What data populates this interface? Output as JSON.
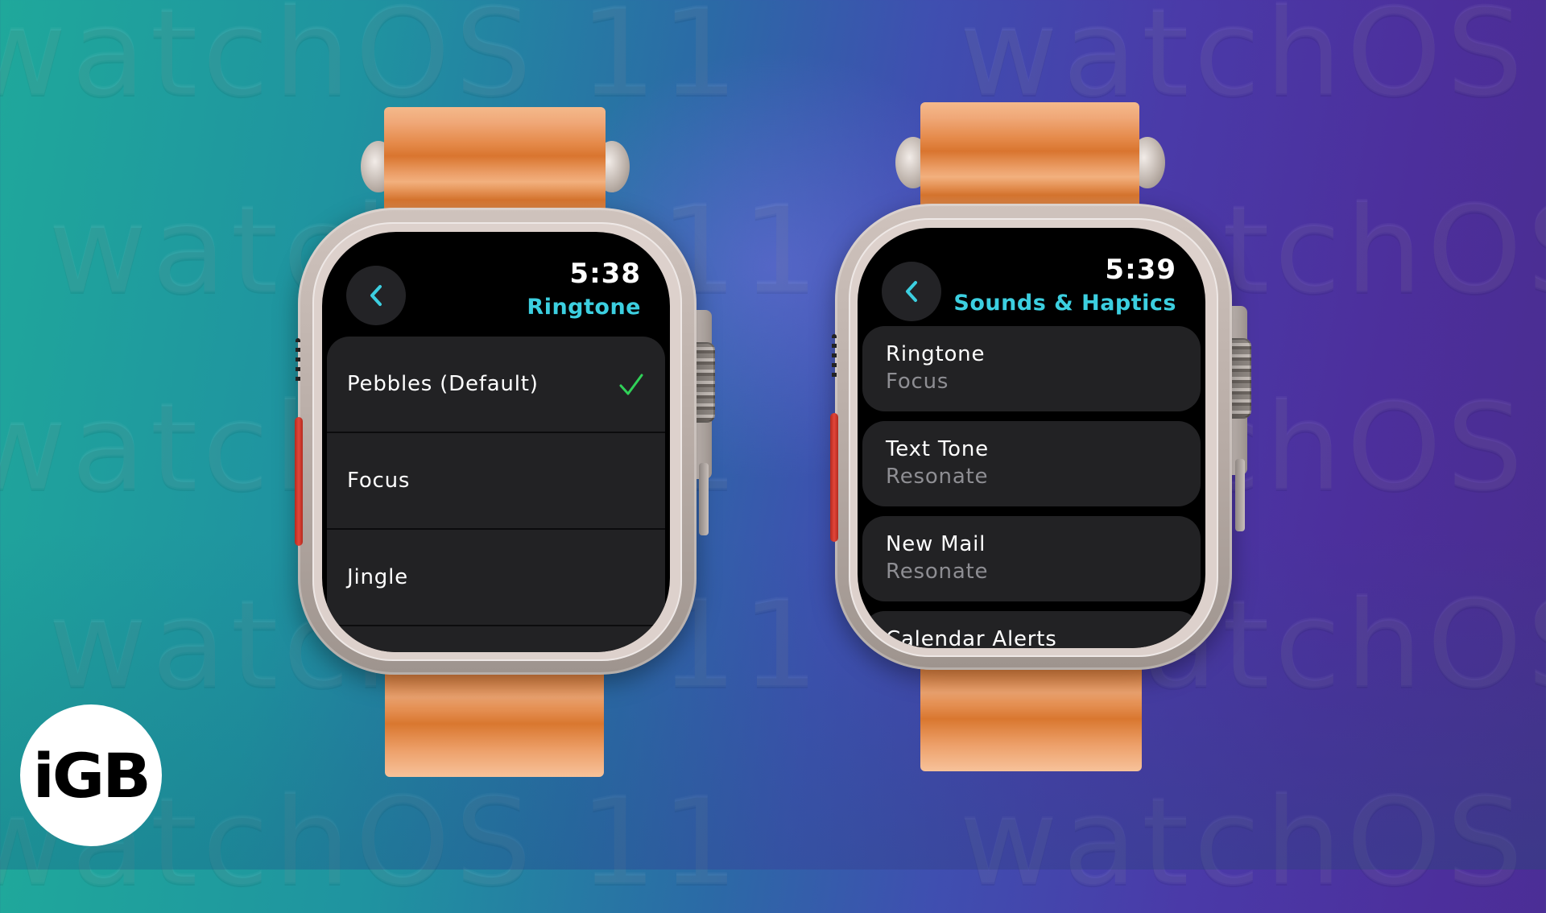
{
  "background": {
    "watermark_text": "watchOS 11",
    "colors": {
      "left": "#1fa89b",
      "center": "#3f4fb0",
      "right": "#4a2d8e"
    }
  },
  "colors": {
    "accent": "#3ccfe0",
    "checkmark": "#30d158",
    "row_bg": "#222224",
    "secondary_text": "#8e8e93",
    "band": "#e2843f",
    "action_button": "#e2463a"
  },
  "watch_left": {
    "time": "5:38",
    "title": "Ringtone",
    "back_icon": "chevron-left-icon",
    "items": [
      {
        "label": "Pebbles (Default)",
        "selected": true
      },
      {
        "label": "Focus",
        "selected": false
      },
      {
        "label": "Jingle",
        "selected": false
      }
    ]
  },
  "watch_right": {
    "time": "5:39",
    "title": "Sounds & Haptics",
    "back_icon": "chevron-left-icon",
    "items": [
      {
        "label": "Ringtone",
        "value": "Focus"
      },
      {
        "label": "Text Tone",
        "value": "Resonate"
      },
      {
        "label": "New Mail",
        "value": "Resonate"
      },
      {
        "label": "Calendar Alerts",
        "value": ""
      }
    ]
  },
  "logo": {
    "text": "iGB"
  }
}
